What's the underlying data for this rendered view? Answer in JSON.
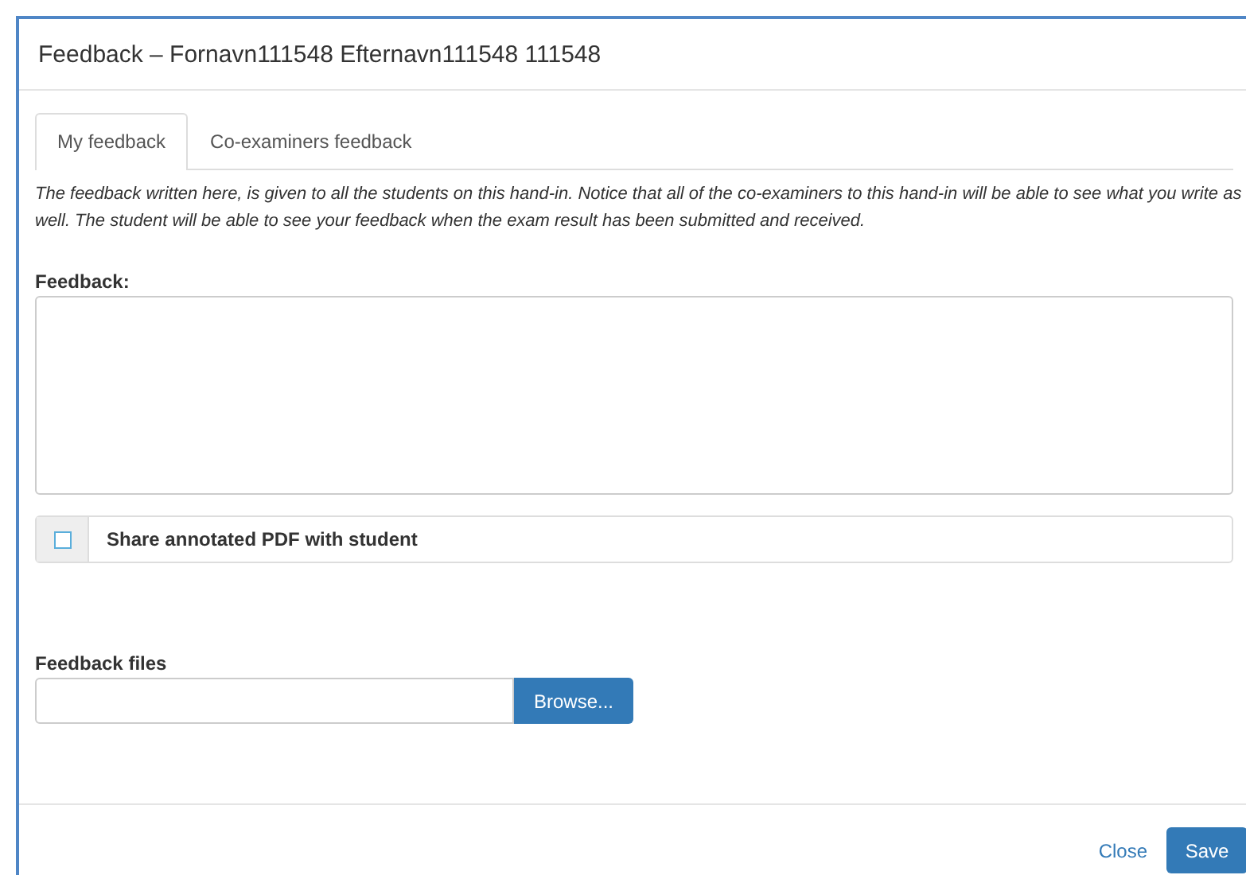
{
  "dialog": {
    "title": "Feedback – Fornavn111548 Efternavn111548 111548"
  },
  "tabs": [
    {
      "label": "My feedback",
      "selected": true
    },
    {
      "label": "Co-examiners feedback",
      "selected": false
    }
  ],
  "notice": "The feedback written here, is given to all the students on this hand-in. Notice that all of the co-examiners to this hand-in will be able to see what you write as well. The student will be able to see your feedback when the exam result has been submitted and received.",
  "feedback": {
    "label": "Feedback:"
  },
  "share_pdf": {
    "label": "Share annotated PDF with student",
    "checked": false
  },
  "files": {
    "label": "Feedback files",
    "button": "Browse..."
  },
  "footer": {
    "close": "Close",
    "save": "Save"
  }
}
